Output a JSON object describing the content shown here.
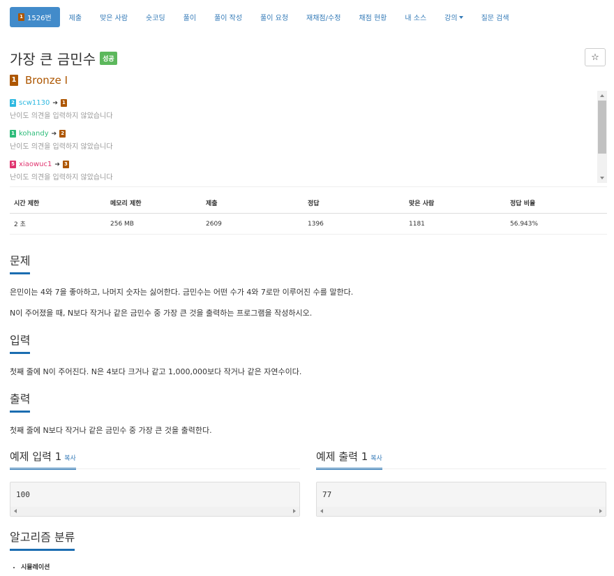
{
  "nav": {
    "problem_number": "1526번",
    "items": [
      "제출",
      "맞은 사람",
      "숏코딩",
      "풀이",
      "풀이 작성",
      "풀이 요청",
      "재채점/수정",
      "채점 현황",
      "내 소스",
      "강의",
      "질문 검색"
    ]
  },
  "problem": {
    "title": "가장 큰 금민수",
    "status_badge": "성공",
    "level_tier": "1",
    "level": "Bronze I",
    "star": "☆"
  },
  "opinions": [
    {
      "user": "scw1130",
      "from_tier": "2",
      "to_tier": "1",
      "user_color": "#2db8e0",
      "from_color": "#2db8e0",
      "to_color": "#ad5600",
      "note": "난이도 의견을 입력하지 않았습니다"
    },
    {
      "user": "kohandy",
      "from_tier": "1",
      "to_tier": "2",
      "user_color": "#2ebc7a",
      "from_color": "#2ebc7a",
      "to_color": "#ad5600",
      "note": "난이도 의견을 입력하지 않았습니다"
    },
    {
      "user": "xiaowuc1",
      "from_tier": "5",
      "to_tier": "3",
      "user_color": "#e0346f",
      "from_color": "#e0346f",
      "to_color": "#ad5600",
      "note": "난이도 의견을 입력하지 않았습니다"
    }
  ],
  "stats": {
    "headers": [
      "시간 제한",
      "메모리 제한",
      "제출",
      "정답",
      "맞은 사람",
      "정답 비율"
    ],
    "values": [
      "2 초",
      "256 MB",
      "2609",
      "1396",
      "1181",
      "56.943%"
    ]
  },
  "sections": {
    "problem_heading": "문제",
    "problem_p1": "은민이는 4와 7을 좋아하고, 나머지 숫자는 싫어한다. 금민수는 어떤 수가 4와 7로만 이루어진 수를 말한다.",
    "problem_p2": "N이 주어졌을 때, N보다 작거나 같은 금민수 중 가장 큰 것을 출력하는 프로그램을 작성하시오.",
    "input_heading": "입력",
    "input_p": "첫째 줄에 N이 주어진다. N은 4보다 크거나 같고 1,000,000보다 작거나 같은 자연수이다.",
    "output_heading": "출력",
    "output_p": "첫째 줄에 N보다 작거나 같은 금민수 중 가장 큰 것을 출력한다."
  },
  "examples": {
    "input_heading": "예제 입력 1",
    "output_heading": "예제 출력 1",
    "copy_label": "복사",
    "input_value": "100",
    "output_value": "77"
  },
  "algorithm": {
    "heading": "알고리즘 분류",
    "tags": [
      "시뮬레이션"
    ]
  }
}
